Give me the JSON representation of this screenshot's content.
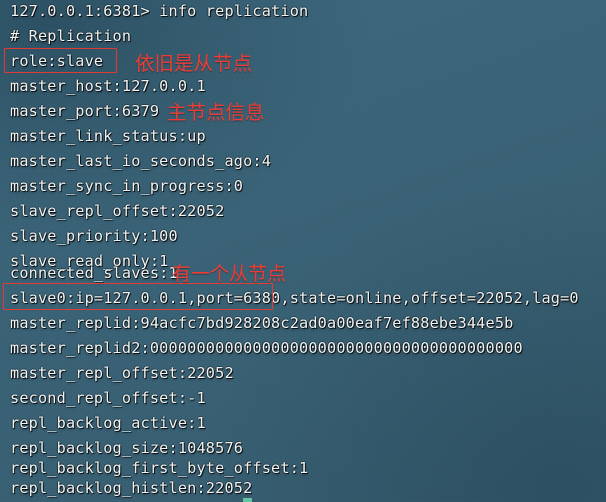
{
  "terminal": {
    "background_color": "#3a6377",
    "text_color": "#f2f4f3",
    "annotation_color": "#ef3b33",
    "prompt": "127.0.0.1:6381>",
    "command": "info replication",
    "lines": [
      {
        "text": "127.0.0.1:6381> info replication"
      },
      {
        "text": "# Replication"
      },
      {
        "text": "role:slave"
      },
      {
        "text": "master_host:127.0.0.1"
      },
      {
        "text": "master_port:6379"
      },
      {
        "text": "master_link_status:up"
      },
      {
        "text": "master_last_io_seconds_ago:4"
      },
      {
        "text": "master_sync_in_progress:0"
      },
      {
        "text": "slave_repl_offset:22052"
      },
      {
        "text": "slave_priority:100"
      },
      {
        "text": "slave_read_only:1"
      },
      {
        "text": "connected_slaves:1"
      },
      {
        "text": "slave0:ip=127.0.0.1,port=6380,state=online,offset=22052,lag=0"
      },
      {
        "text": "master_replid:94acfc7bd928208c2ad0a00eaf7ef88ebe344e5b"
      },
      {
        "text": "master_replid2:0000000000000000000000000000000000000000"
      },
      {
        "text": "master_repl_offset:22052"
      },
      {
        "text": "second_repl_offset:-1"
      },
      {
        "text": "repl_backlog_active:1"
      },
      {
        "text": "repl_backlog_size:1048576"
      },
      {
        "text": "repl_backlog_first_byte_offset:1"
      },
      {
        "text": "repl_backlog_histlen:22052"
      }
    ]
  },
  "annotations": {
    "note_role": "依旧是从节点",
    "note_master": "主节点信息",
    "note_slave": "有一个从节点"
  }
}
